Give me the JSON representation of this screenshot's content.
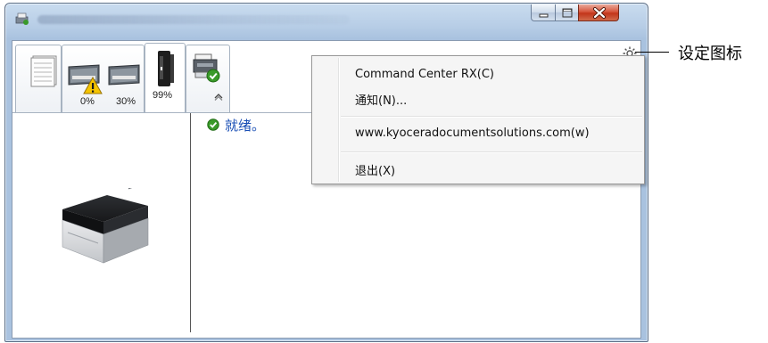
{
  "window": {
    "title": "",
    "controls": [
      "minimize",
      "maximize",
      "close"
    ]
  },
  "tabs": [
    {
      "name": "paper-tab",
      "icon": "paper-stack-icon",
      "label": ""
    },
    {
      "name": "toner-tab",
      "icon": "toner-cartridge-icon",
      "labels": [
        "0%",
        "30%"
      ],
      "warning": true
    },
    {
      "name": "toner-level-tab",
      "icon": "toner-bottle-icon",
      "label": "99%"
    },
    {
      "name": "device-tab",
      "icon": "printer-ok-icon",
      "label": ""
    }
  ],
  "status": {
    "icon": "check-circle-icon",
    "text": "就绪。"
  },
  "menu": {
    "items": [
      {
        "label": "Command Center RX(C)"
      },
      {
        "label": "通知(N)..."
      },
      {
        "label": "www.kyoceradocumentsolutions.com(w)"
      },
      {
        "label": "退出(X)"
      }
    ]
  },
  "callout": {
    "label": "设定图标"
  },
  "colors": {
    "status_text": "#1a4fb5",
    "close_button": "#c2351b",
    "check_green": "#3a9a2a"
  }
}
